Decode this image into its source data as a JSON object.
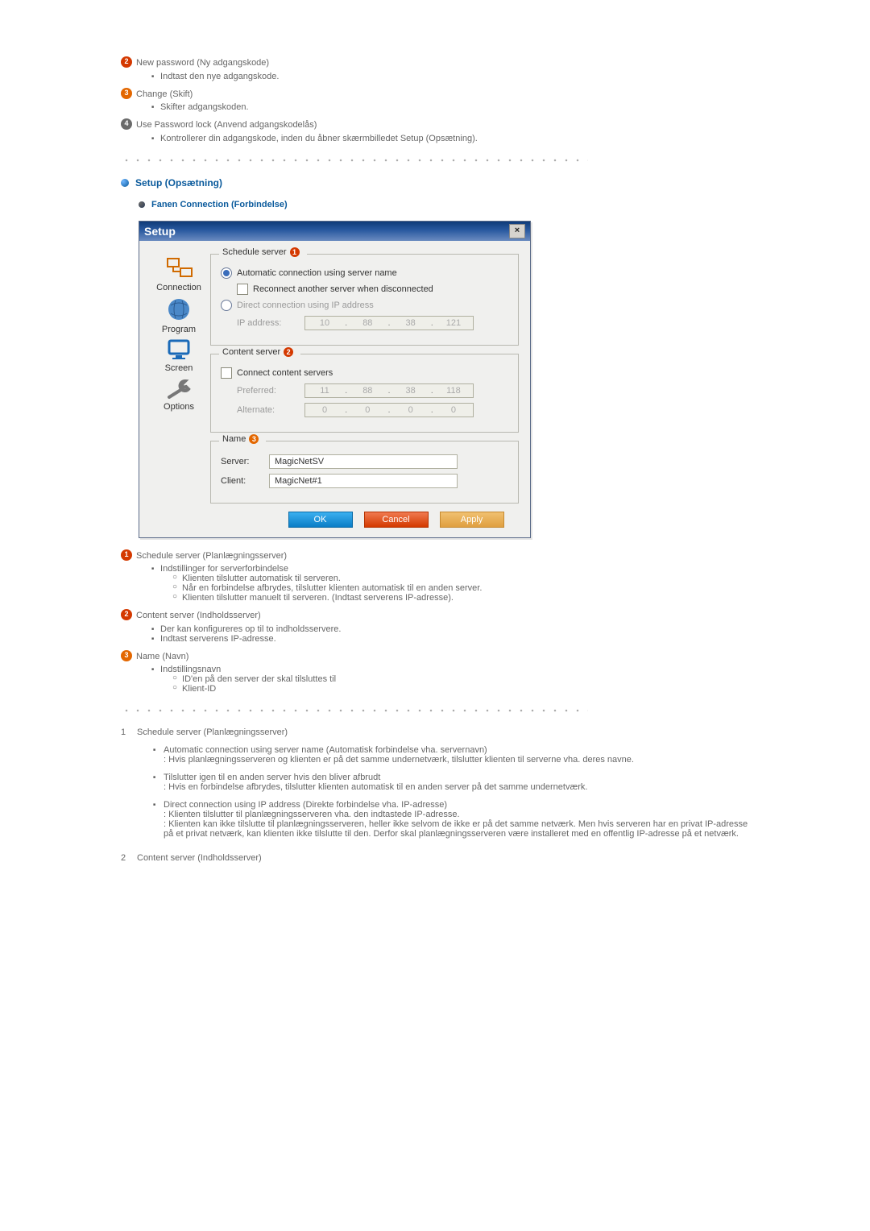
{
  "top": {
    "i2": "New password (Ny adgangskode)",
    "i2_sub": "Indtast den nye adgangskode.",
    "i3": "Change (Skift)",
    "i3_sub": "Skifter adgangskoden.",
    "i4": "Use Password lock (Anvend adgangskodelås)",
    "i4_sub": "Kontrollerer din adgangskode, inden du åbner skærmbilledet Setup (Opsætning)."
  },
  "section": {
    "title": "Setup (Opsætning)",
    "tab_title": "Fanen Connection (Forbindelse)"
  },
  "dialog": {
    "title": "Setup",
    "close": "×",
    "tabs": {
      "connection": "Connection",
      "program": "Program",
      "screen": "Screen",
      "options": "Options"
    },
    "fs1": {
      "legend": "Schedule server",
      "radio_auto": "Automatic connection using server name",
      "chk_reconnect": "Reconnect another server when disconnected",
      "radio_direct": "Direct connection using IP address",
      "ip_label": "IP address:",
      "ip": [
        "10",
        "88",
        "38",
        "121"
      ]
    },
    "fs2": {
      "legend": "Content server",
      "chk_connect": "Connect content servers",
      "pref_label": "Preferred:",
      "pref_ip": [
        "11",
        "88",
        "38",
        "118"
      ],
      "alt_label": "Alternate:",
      "alt_ip": [
        "0",
        "0",
        "0",
        "0"
      ]
    },
    "fs3": {
      "legend": "Name",
      "server_label": "Server:",
      "server_value": "MagicNetSV",
      "client_label": "Client:",
      "client_value": "MagicNet#1"
    },
    "buttons": {
      "ok": "OK",
      "cancel": "Cancel",
      "apply": "Apply"
    }
  },
  "notes": {
    "n1": {
      "title": "Schedule server (Planlægningsserver)",
      "b1": "Indstillinger for serverforbindelse",
      "b1a": "Klienten tilslutter automatisk til serveren.",
      "b1b": "Når en forbindelse afbrydes, tilslutter klienten automatisk til en anden server.",
      "b1c": "Klienten tilslutter manuelt til serveren. (Indtast serverens IP-adresse)."
    },
    "n2": {
      "title": "Content server (Indholdsserver)",
      "b1": "Der kan konfigureres op til to indholdsservere.",
      "b2": "Indtast serverens IP-adresse."
    },
    "n3": {
      "title": "Name (Navn)",
      "b1": "Indstillingsnavn",
      "b1a": "ID'en på den server der skal tilsluttes til",
      "b1b": "Klient-ID"
    }
  },
  "details": {
    "d1": {
      "num": "1",
      "title": "Schedule server (Planlægningsserver)",
      "p1t": "Automatic connection using server name (Automatisk forbindelse vha. servernavn)",
      "p1b": ": Hvis planlægningsserveren og klienten er på det samme undernetværk, tilslutter klienten til serverne vha. deres navne.",
      "p2t": "Tilslutter igen til en anden server hvis den bliver afbrudt",
      "p2b": ": Hvis en forbindelse afbrydes, tilslutter klienten automatisk til en anden server på det samme undernetværk.",
      "p3t": "Direct connection using IP address (Direkte forbindelse vha. IP-adresse)",
      "p3b": ": Klienten tilslutter til planlægningsserveren vha. den indtastede IP-adresse.",
      "p3c": ": Klienten kan ikke tilslutte til planlægningsserveren, heller ikke selvom de ikke er på det samme netværk. Men hvis serveren har en privat IP-adresse på et privat netværk, kan klienten ikke tilslutte til den. Derfor skal planlægningsserveren være installeret med en offentlig IP-adresse på et netværk."
    },
    "d2": {
      "num": "2",
      "title": "Content server (Indholdsserver)"
    }
  }
}
